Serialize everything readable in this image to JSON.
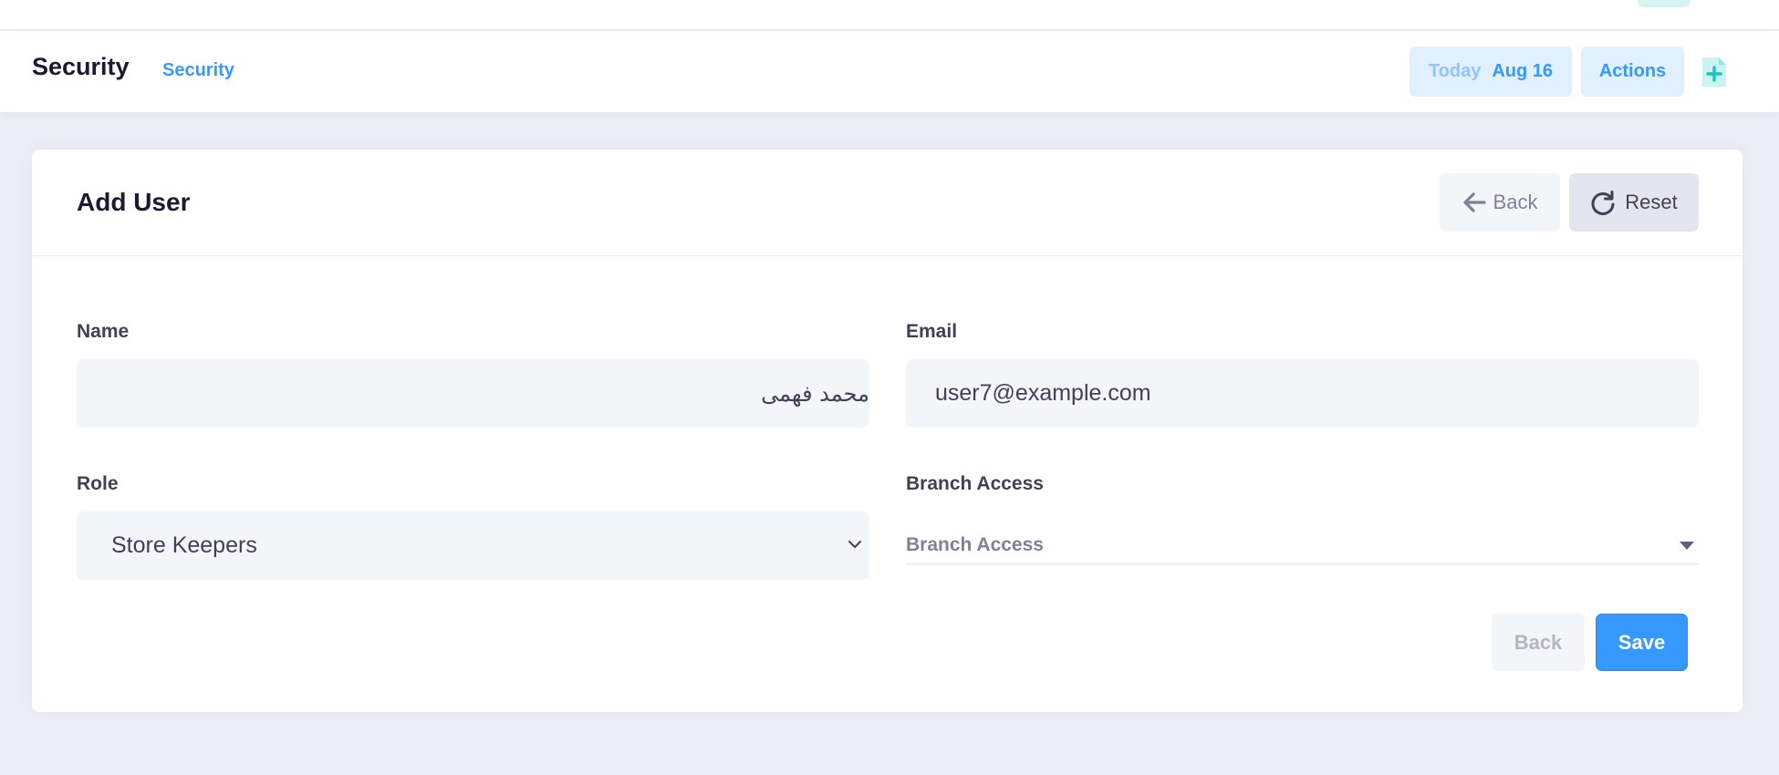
{
  "subheader": {
    "title": "Security",
    "breadcrumb": "Security",
    "date_label": "Today",
    "date_value": "Aug 16",
    "actions_label": "Actions"
  },
  "card": {
    "title": "Add User",
    "back_label": "Back",
    "reset_label": "Reset"
  },
  "form": {
    "name": {
      "label": "Name",
      "value": "محمد فهمى"
    },
    "email": {
      "label": "Email",
      "value": "user7@example.com"
    },
    "role": {
      "label": "Role",
      "value": "Store Keepers"
    },
    "branch": {
      "label": "Branch Access",
      "placeholder": "Branch Access"
    }
  },
  "footer": {
    "back_label": "Back",
    "save_label": "Save"
  },
  "colors": {
    "primary": "#3699ff",
    "primary_light": "#e1f0ff",
    "accent_teal": "#1bc5bd",
    "background": "#eceef6"
  },
  "icons": [
    "arrow-left-icon",
    "redo-icon",
    "file-plus-icon",
    "chevron-down-icon",
    "caret-down-icon"
  ]
}
